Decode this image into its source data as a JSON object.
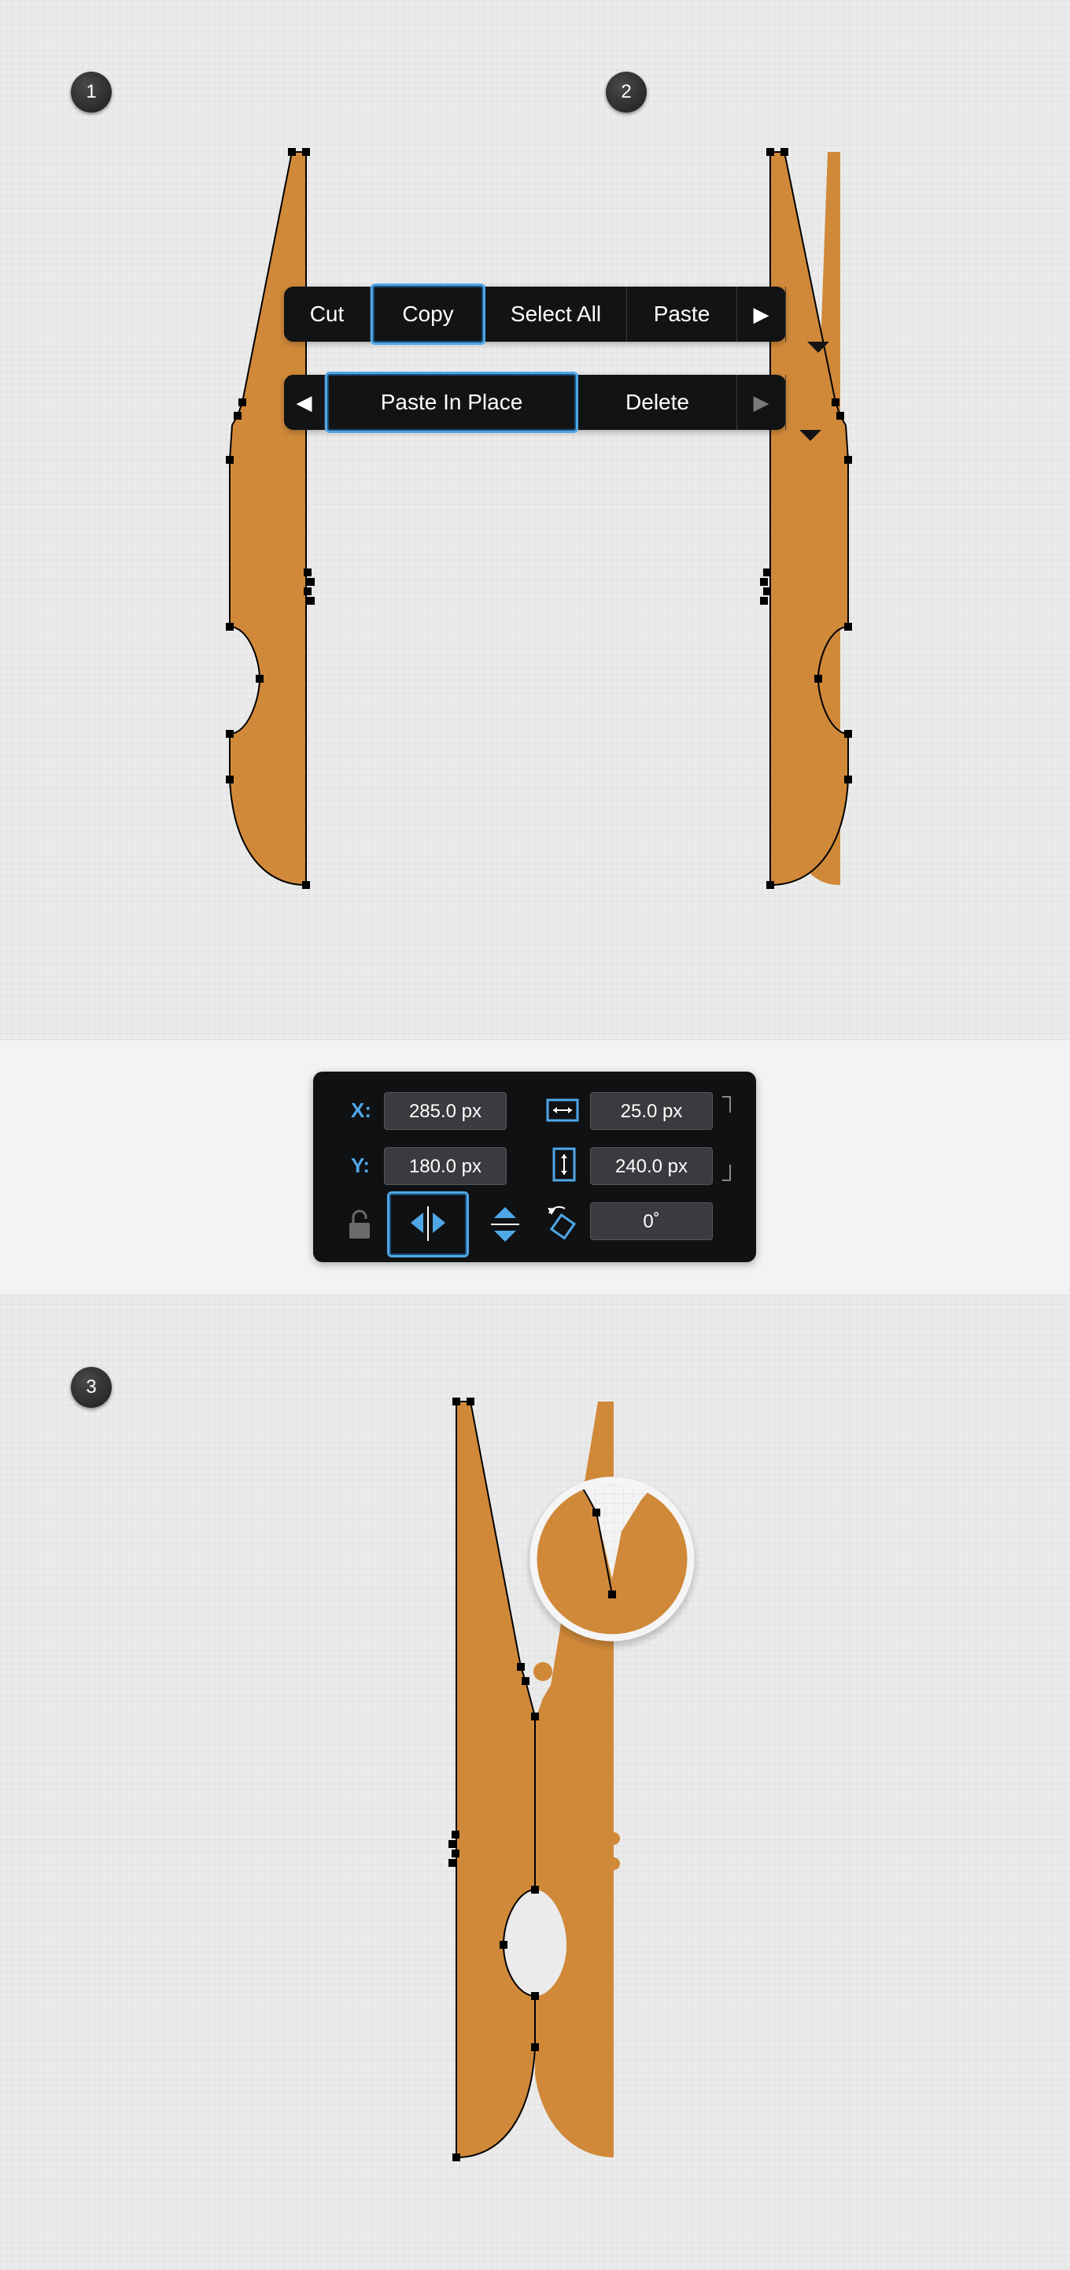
{
  "steps": [
    "1",
    "2",
    "3"
  ],
  "context_menu": {
    "row1": {
      "items": [
        "Cut",
        "Copy",
        "Select All",
        "Paste"
      ],
      "selected": "Copy",
      "next_arrow": "▶"
    },
    "row2": {
      "prev_arrow": "◀",
      "items": [
        "Paste In Place",
        "Delete"
      ],
      "selected": "Paste In Place",
      "next_arrow": "▶"
    }
  },
  "transform_panel": {
    "x_label": "X:",
    "y_label": "Y:",
    "x_value": "285.0 px",
    "y_value": "180.0 px",
    "width_value": "25.0 px",
    "height_value": "240.0 px",
    "rotation_value": "0˚",
    "icons": [
      "width-icon",
      "height-icon",
      "lock-icon",
      "flip-horizontal-icon",
      "flip-vertical-icon",
      "rotate-icon"
    ],
    "selected_tool": "flip-horizontal"
  },
  "colors": {
    "shape_fill": "#d08939",
    "accent": "#4fa7e8",
    "menu_bg": "#121314",
    "panel_bg": "#101113"
  }
}
